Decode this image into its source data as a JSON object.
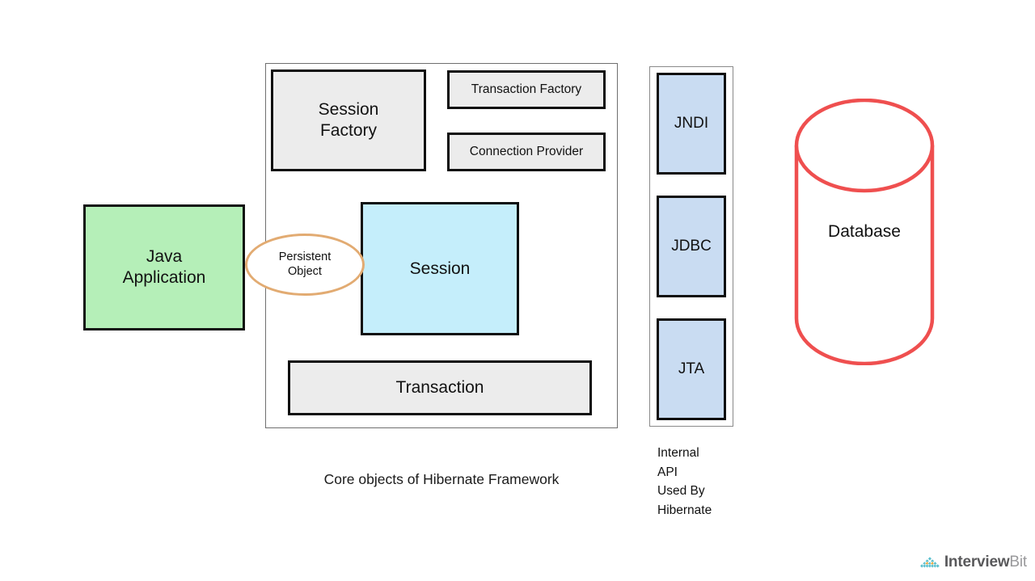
{
  "diagram": {
    "title": "Core objects of Hibernate Framework",
    "java_application": "Java\nApplication",
    "persistent_object": "Persistent\nObject",
    "core_boxes": {
      "session_factory": "Session\nFactory",
      "transaction_factory": "Transaction Factory",
      "connection_provider": "Connection Provider",
      "session": "Session",
      "transaction": "Transaction"
    },
    "internal_api": {
      "items": [
        {
          "label": "JNDI"
        },
        {
          "label": "JDBC"
        },
        {
          "label": "JTA"
        }
      ],
      "caption": "Internal\nAPI\nUsed By\nHibernate"
    },
    "database": {
      "label": "Database"
    }
  },
  "colors": {
    "java_application_fill": "#b5efb8",
    "gray_box_fill": "#ececec",
    "session_fill": "#c5eefb",
    "api_fill": "#c9dcf2",
    "persistent_object_stroke": "#e2ab72",
    "database_stroke": "#ef4f4f",
    "box_stroke": "#0e0e0e",
    "container_stroke": "#6f6f6f"
  },
  "branding": {
    "logo_name_primary": "Interview",
    "logo_name_secondary": "Bit",
    "logo_icon": "diamond-grid-logo",
    "logo_teal": "#5bc0ce",
    "logo_orange": "#f0a73c"
  }
}
